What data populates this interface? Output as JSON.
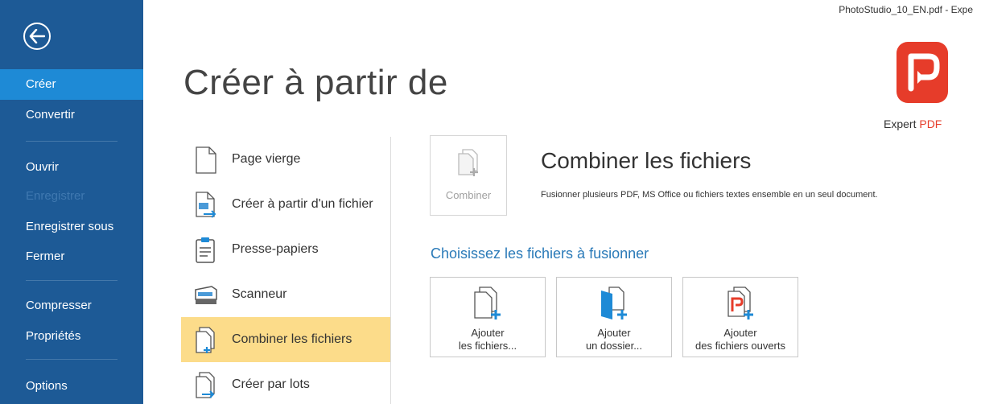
{
  "window": {
    "title": "PhotoStudio_10_EN.pdf  -  Expe"
  },
  "sidebar": {
    "items": [
      {
        "label": "Créer",
        "state": "active"
      },
      {
        "label": "Convertir",
        "state": "normal"
      },
      {
        "label": "Ouvrir",
        "state": "normal"
      },
      {
        "label": "Enregistrer",
        "state": "disabled"
      },
      {
        "label": "Enregistrer sous",
        "state": "normal"
      },
      {
        "label": "Fermer",
        "state": "normal"
      },
      {
        "label": "Compresser",
        "state": "normal"
      },
      {
        "label": "Propriétés",
        "state": "normal"
      },
      {
        "label": "Options",
        "state": "normal"
      }
    ],
    "back_icon": "back-arrow-icon"
  },
  "header": {
    "title": "Créer à partir de"
  },
  "logo": {
    "name_part1": "Expert",
    "name_part2": "PDF",
    "color": "#e63c2a"
  },
  "create_options": [
    {
      "label": "Page vierge",
      "icon": "blank-page-icon"
    },
    {
      "label": "Créer à partir d'un fichier",
      "icon": "from-file-icon"
    },
    {
      "label": "Presse-papiers",
      "icon": "clipboard-icon"
    },
    {
      "label": "Scanneur",
      "icon": "scanner-icon"
    },
    {
      "label": "Combiner les fichiers",
      "icon": "combine-files-icon",
      "selected": true
    },
    {
      "label": "Créer par lots",
      "icon": "batch-create-icon"
    }
  ],
  "panel": {
    "combine_button": "Combiner",
    "title": "Combiner les fichiers",
    "description": "Fusionner plusieurs PDF, MS Office ou fichiers textes ensemble en un seul document.",
    "choose_title": "Choisissez les fichiers à fusionner",
    "tiles": [
      {
        "line1": "Ajouter",
        "line2": "les fichiers...",
        "icon": "add-files-icon"
      },
      {
        "line1": "Ajouter",
        "line2": "un dossier...",
        "icon": "add-folder-icon"
      },
      {
        "line1": "Ajouter",
        "line2": "des fichiers ouverts",
        "icon": "add-open-files-icon"
      }
    ]
  },
  "colors": {
    "sidebar": "#1d5a96",
    "active": "#1e8ad6",
    "selected": "#fcdc8a",
    "accent": "#2a7ab8"
  }
}
